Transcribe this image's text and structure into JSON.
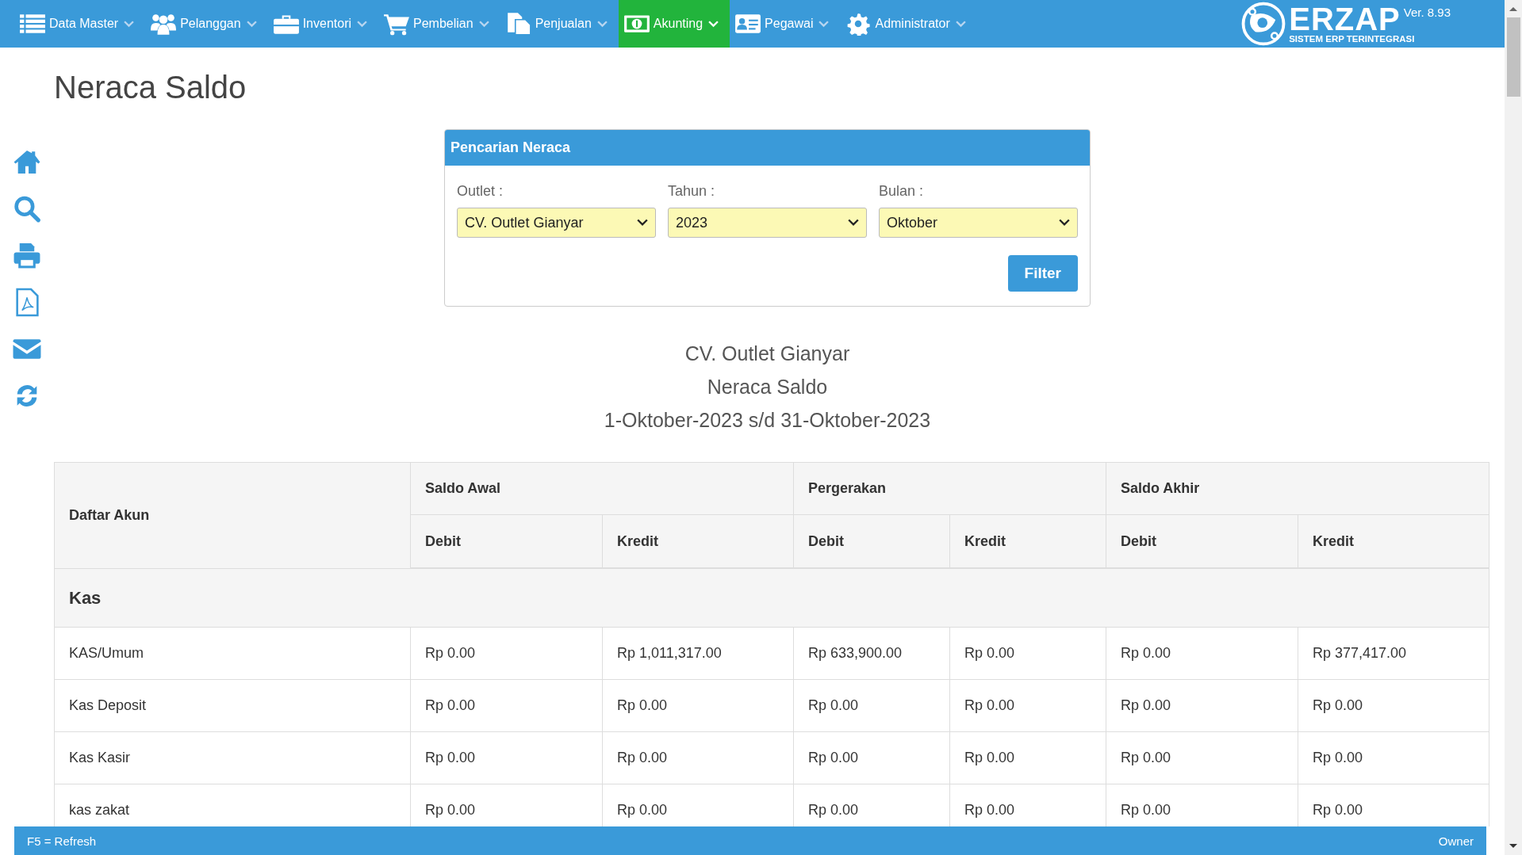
{
  "nav": {
    "items": [
      {
        "label": "Data Master",
        "selected": false
      },
      {
        "label": "Pelanggan",
        "selected": false
      },
      {
        "label": "Inventori",
        "selected": false
      },
      {
        "label": "Pembelian",
        "selected": false
      },
      {
        "label": "Penjualan",
        "selected": false
      },
      {
        "label": "Akunting",
        "selected": true
      },
      {
        "label": "Pegawai",
        "selected": false
      },
      {
        "label": "Administrator",
        "selected": false
      }
    ],
    "logo": {
      "name": "ERZAP",
      "version": "Ver. 8.93",
      "tagline": "SISTEM ERP TERINTEGRASI"
    }
  },
  "page_title": "Neraca Saldo",
  "search_panel": {
    "title": "Pencarian Neraca",
    "fields": [
      {
        "label": "Outlet :",
        "value": "CV. Outlet Gianyar"
      },
      {
        "label": "Tahun :",
        "value": "2023"
      },
      {
        "label": "Bulan :",
        "value": "Oktober"
      }
    ],
    "button": "Filter"
  },
  "report_heading": [
    "CV. Outlet Gianyar",
    "Neraca Saldo",
    "1-Oktober-2023 s/d 31-Oktober-2023"
  ],
  "table": {
    "first_column": "Daftar Akun",
    "groups": [
      {
        "label": "Saldo Awal",
        "columns": [
          "Debit",
          "Kredit"
        ]
      },
      {
        "label": "Pergerakan",
        "columns": [
          "Debit",
          "Kredit"
        ]
      },
      {
        "label": "Saldo Akhir",
        "columns": [
          "Debit",
          "Kredit"
        ]
      }
    ],
    "sections": [
      {
        "title": "Kas",
        "rows": [
          {
            "account": "KAS/Umum",
            "cells": [
              "Rp 0.00",
              "Rp 1,011,317.00",
              "Rp 633,900.00",
              "Rp 0.00",
              "Rp 0.00",
              "Rp 377,417.00"
            ]
          },
          {
            "account": "Kas Deposit",
            "cells": [
              "Rp 0.00",
              "Rp 0.00",
              "Rp 0.00",
              "Rp 0.00",
              "Rp 0.00",
              "Rp 0.00"
            ]
          },
          {
            "account": "Kas Kasir",
            "cells": [
              "Rp 0.00",
              "Rp 0.00",
              "Rp 0.00",
              "Rp 0.00",
              "Rp 0.00",
              "Rp 0.00"
            ]
          },
          {
            "account": "kas zakat",
            "cells": [
              "Rp 0.00",
              "Rp 0.00",
              "Rp 0.00",
              "Rp 0.00",
              "Rp 0.00",
              "Rp 0.00"
            ]
          }
        ]
      }
    ]
  },
  "status_bar": {
    "left": "F5 = Refresh",
    "right": "Owner"
  }
}
